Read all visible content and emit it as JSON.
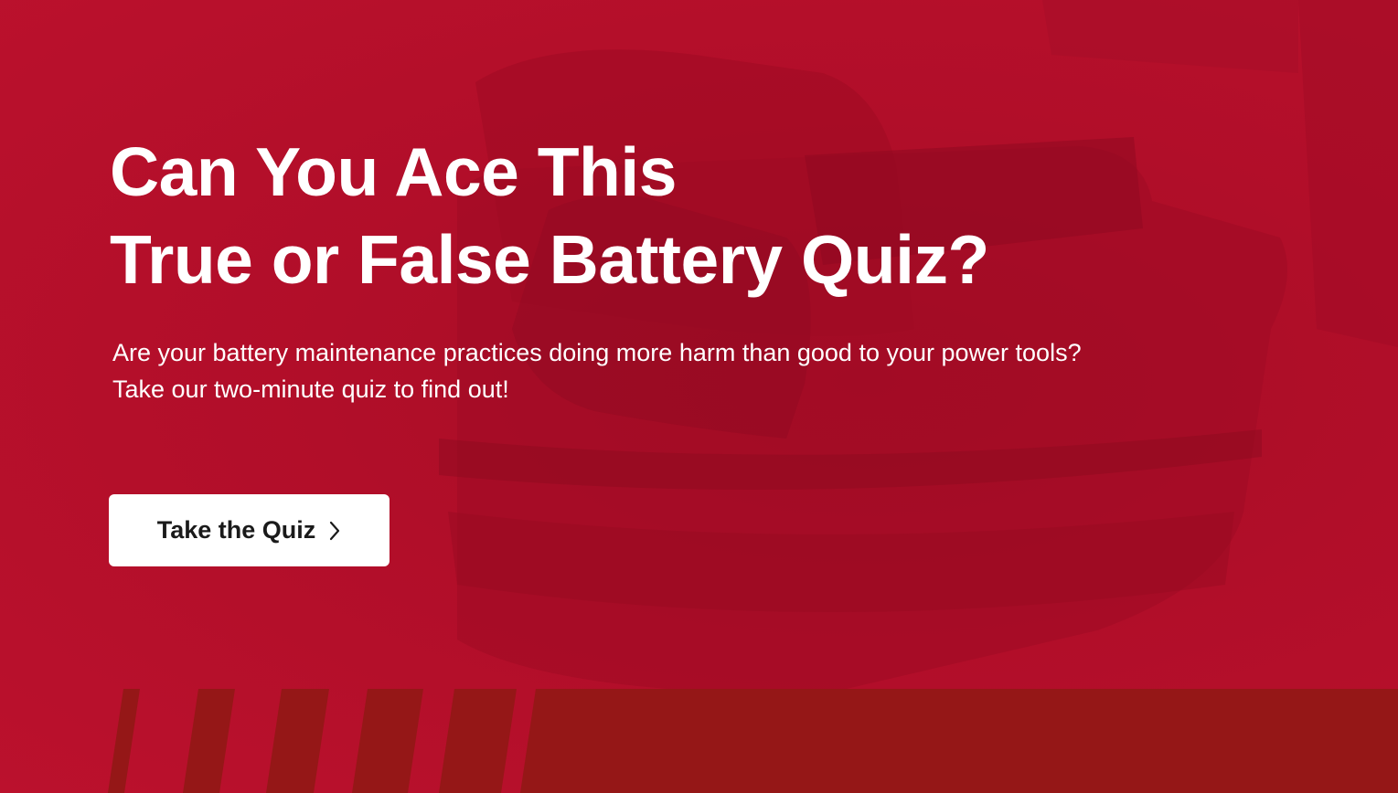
{
  "hero": {
    "title_lines": [
      "Can You Ace This",
      "True or False Battery Quiz?"
    ],
    "subtitle_lines": [
      "Are your battery maintenance practices doing more harm than good to your power tools?",
      "Take our two-minute quiz to find out!"
    ]
  },
  "cta": {
    "label": "Take the Quiz",
    "icon": "chevron-right-icon"
  },
  "colors": {
    "background": "#b80f2b",
    "band": "#951717",
    "button_bg": "#ffffff",
    "button_text": "#1a1a1a",
    "text": "#ffffff"
  }
}
